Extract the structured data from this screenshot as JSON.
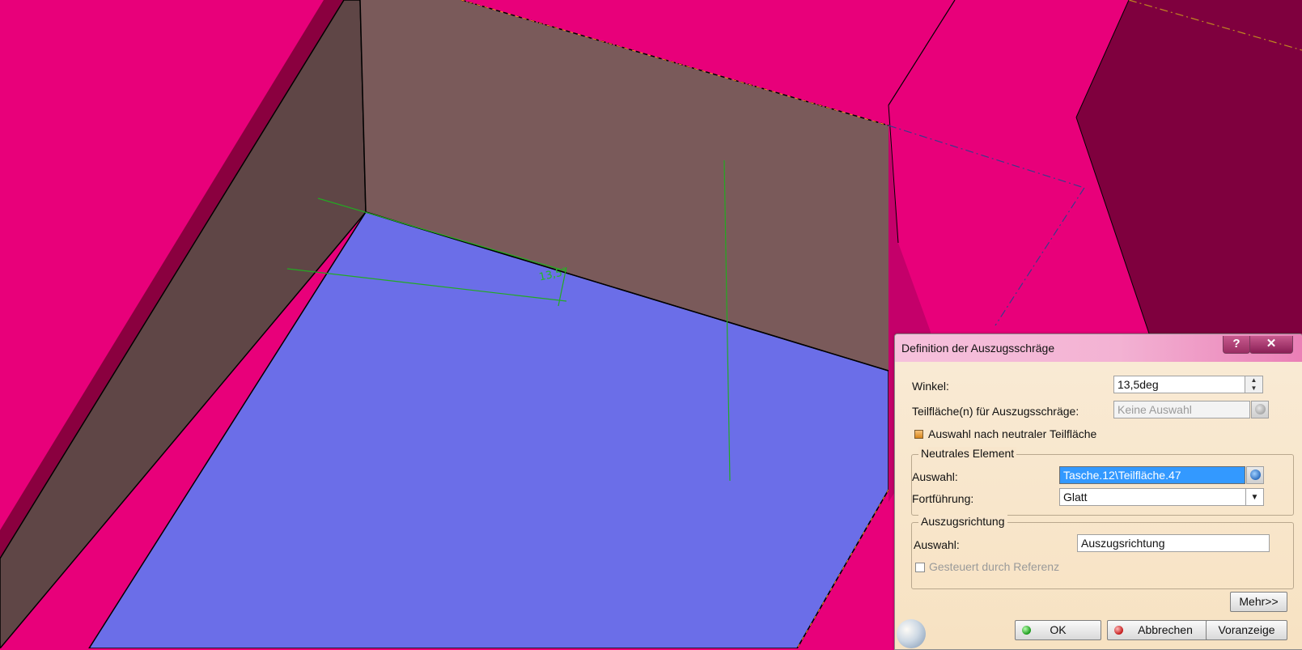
{
  "viewport": {
    "dimension_label": "13,5°",
    "colors": {
      "pink": "#e8007a",
      "dark_pink": "#c4006a",
      "wall_brown": "#7a5a5a",
      "left_wall": "#5f4646",
      "floor_blue": "#6b6ee8",
      "green_line": "#22aa22"
    }
  },
  "dialog": {
    "title": "Definition der Auszugsschräge",
    "help_label": "?",
    "close_label": "✕",
    "winkel_label": "Winkel:",
    "winkel_value": "13,5deg",
    "teilflaechen_label": "Teilfläche(n) für Auszugsschräge:",
    "teilflaechen_value": "Keine Auswahl",
    "auswahl_neutral_label": "Auswahl nach neutraler Teilfläche",
    "neutral_group": {
      "title": "Neutrales Element",
      "auswahl_label": "Auswahl:",
      "auswahl_value": "Tasche.12\\Teilfläche.47",
      "fortfuehrung_label": "Fortführung:",
      "fortfuehrung_value": "Glatt"
    },
    "richtung_group": {
      "title": "Auszugsrichtung",
      "auswahl_label": "Auswahl:",
      "auswahl_value": "Auszugsrichtung",
      "gesteuert_label": "Gesteuert durch Referenz"
    },
    "mehr_label": "Mehr>>",
    "ok_label": "OK",
    "abbrechen_label": "Abbrechen",
    "voranzeige_label": "Voranzeige"
  }
}
